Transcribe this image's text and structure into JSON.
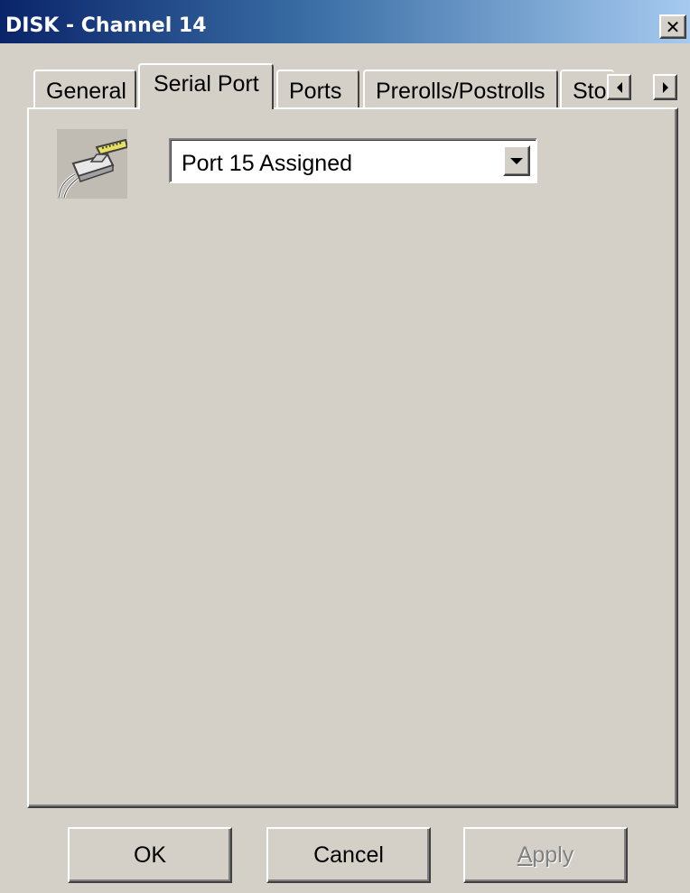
{
  "window": {
    "title": "DISK - Channel 14",
    "close_glyph": "✕"
  },
  "tabs": [
    {
      "label": "General",
      "active": false
    },
    {
      "label": "Serial Port",
      "active": true
    },
    {
      "label": "Ports",
      "active": false
    },
    {
      "label": "Prerolls/Postrolls",
      "active": false
    },
    {
      "label": "Sto",
      "active": false
    }
  ],
  "serial_port": {
    "icon": "serial-cable-icon",
    "port_select": {
      "selected": "Port 15  Assigned"
    }
  },
  "buttons": {
    "ok": "OK",
    "cancel": "Cancel",
    "apply_accel": "A",
    "apply_rest": "pply",
    "apply_enabled": false
  },
  "colors": {
    "title_gradient_start": "#0a246a",
    "title_gradient_end": "#a6caf0",
    "face": "#d4d0c8"
  }
}
